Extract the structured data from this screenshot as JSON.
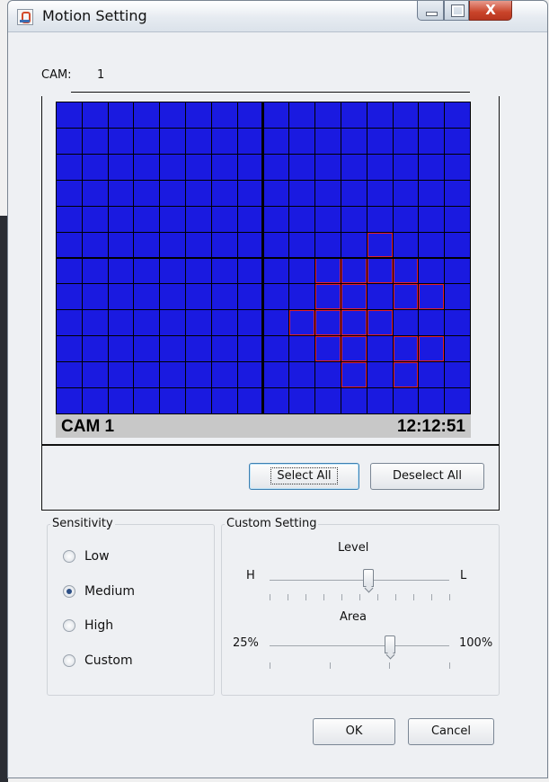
{
  "window": {
    "title": "Motion Setting",
    "close_glyph": "X"
  },
  "camera": {
    "label": "CAM:",
    "value": "1"
  },
  "grid": {
    "cols": 16,
    "rows": 12,
    "selected_cells": [
      [
        5,
        12
      ],
      [
        6,
        10
      ],
      [
        6,
        11
      ],
      [
        6,
        12
      ],
      [
        6,
        13
      ],
      [
        7,
        10
      ],
      [
        7,
        11
      ],
      [
        7,
        13
      ],
      [
        7,
        14
      ],
      [
        8,
        9
      ],
      [
        8,
        10
      ],
      [
        8,
        11
      ],
      [
        8,
        12
      ],
      [
        9,
        10
      ],
      [
        9,
        11
      ],
      [
        9,
        13
      ],
      [
        9,
        14
      ],
      [
        10,
        11
      ],
      [
        10,
        13
      ]
    ]
  },
  "osd": {
    "camera": "CAM 1",
    "time": "12:12:51"
  },
  "actions": {
    "select_all": "Select All",
    "deselect_all": "Deselect All"
  },
  "sensitivity": {
    "title": "Sensitivity",
    "options": [
      "Low",
      "Medium",
      "High",
      "Custom"
    ],
    "selected": "Medium"
  },
  "custom_setting": {
    "title": "Custom Setting",
    "level": {
      "label": "Level",
      "min_label": "H",
      "max_label": "L",
      "value_fraction": 0.55
    },
    "area": {
      "label": "Area",
      "min_label": "25%",
      "max_label": "100%",
      "value_fraction": 0.67
    }
  },
  "footer": {
    "ok": "OK",
    "cancel": "Cancel"
  },
  "colors": {
    "grid_cell": "#1a1ae0",
    "selection": "#e02030",
    "osd_bar": "#c8c8c8"
  }
}
